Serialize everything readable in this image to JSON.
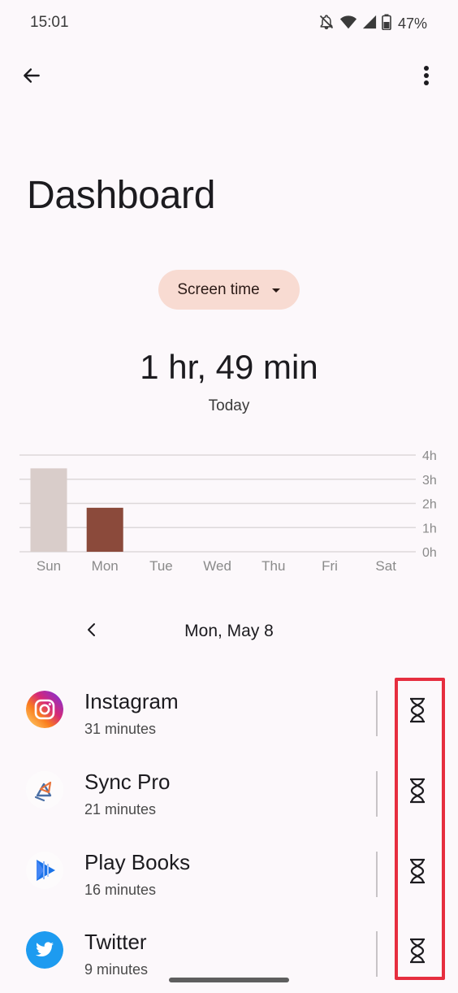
{
  "status_bar": {
    "time": "15:01",
    "battery": "47%",
    "icons": [
      "bell-off-icon",
      "wifi-icon",
      "signal-icon",
      "battery-icon"
    ]
  },
  "header": {
    "title": "Dashboard",
    "back_icon": "arrow-left-icon",
    "menu_icon": "more-vert-icon"
  },
  "metric_selector": {
    "label": "Screen time",
    "icon": "dropdown-arrow-icon"
  },
  "summary": {
    "total": "1 hr, 49 min",
    "day": "Today"
  },
  "chart_data": {
    "type": "bar",
    "categories": [
      "Sun",
      "Mon",
      "Tue",
      "Wed",
      "Thu",
      "Fri",
      "Sat"
    ],
    "values": [
      3.45,
      1.82,
      0,
      0,
      0,
      0,
      0
    ],
    "unit": "h",
    "ylim": [
      0,
      4
    ],
    "ytick_labels": [
      "0h",
      "1h",
      "2h",
      "3h",
      "4h"
    ],
    "grid": true,
    "selected_index": 1,
    "colors": {
      "selected": "#8b4a3b",
      "unselected": "#d9cdca",
      "grid": "#ddd8da",
      "label": "#8a8a8a"
    }
  },
  "day_navigation": {
    "label": "Mon, May 8",
    "prev_icon": "chevron-left-icon"
  },
  "apps": [
    {
      "name": "Instagram",
      "usage": "31 minutes",
      "icon": "instagram-icon",
      "timer_icon": "hourglass-icon"
    },
    {
      "name": "Sync Pro",
      "usage": "21 minutes",
      "icon": "sync-pro-icon",
      "timer_icon": "hourglass-icon"
    },
    {
      "name": "Play Books",
      "usage": "16 minutes",
      "icon": "play-books-icon",
      "timer_icon": "hourglass-icon"
    },
    {
      "name": "Twitter",
      "usage": "9 minutes",
      "icon": "twitter-icon",
      "timer_icon": "hourglass-icon"
    }
  ],
  "theme": {
    "accent_chip": "#f8dbd2",
    "highlight": "#e62e3f",
    "background": "#fcf8fb"
  }
}
